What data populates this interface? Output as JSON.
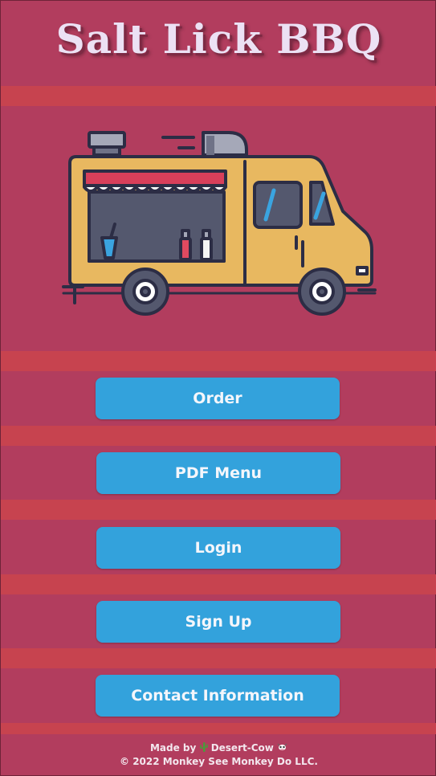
{
  "app": {
    "title": "Salt Lick BBQ"
  },
  "hero": {
    "image": "food-truck-illustration"
  },
  "buttons": {
    "order": "Order",
    "pdf_menu": "PDF Menu",
    "login": "Login",
    "sign_up": "Sign Up",
    "contact": "Contact Information"
  },
  "footer": {
    "made_by_prefix": "Made by",
    "made_by_name": "Desert-Cow",
    "copyright": "© 2022 Monkey See Monkey Do LLC."
  },
  "icons": {
    "made_by_left": "cactus-icon",
    "made_by_right": "cow-icon"
  },
  "colors": {
    "background": "#b23d5e",
    "stripe": "#c7434f",
    "button": "#33a2dc",
    "title": "#ece1f4"
  }
}
